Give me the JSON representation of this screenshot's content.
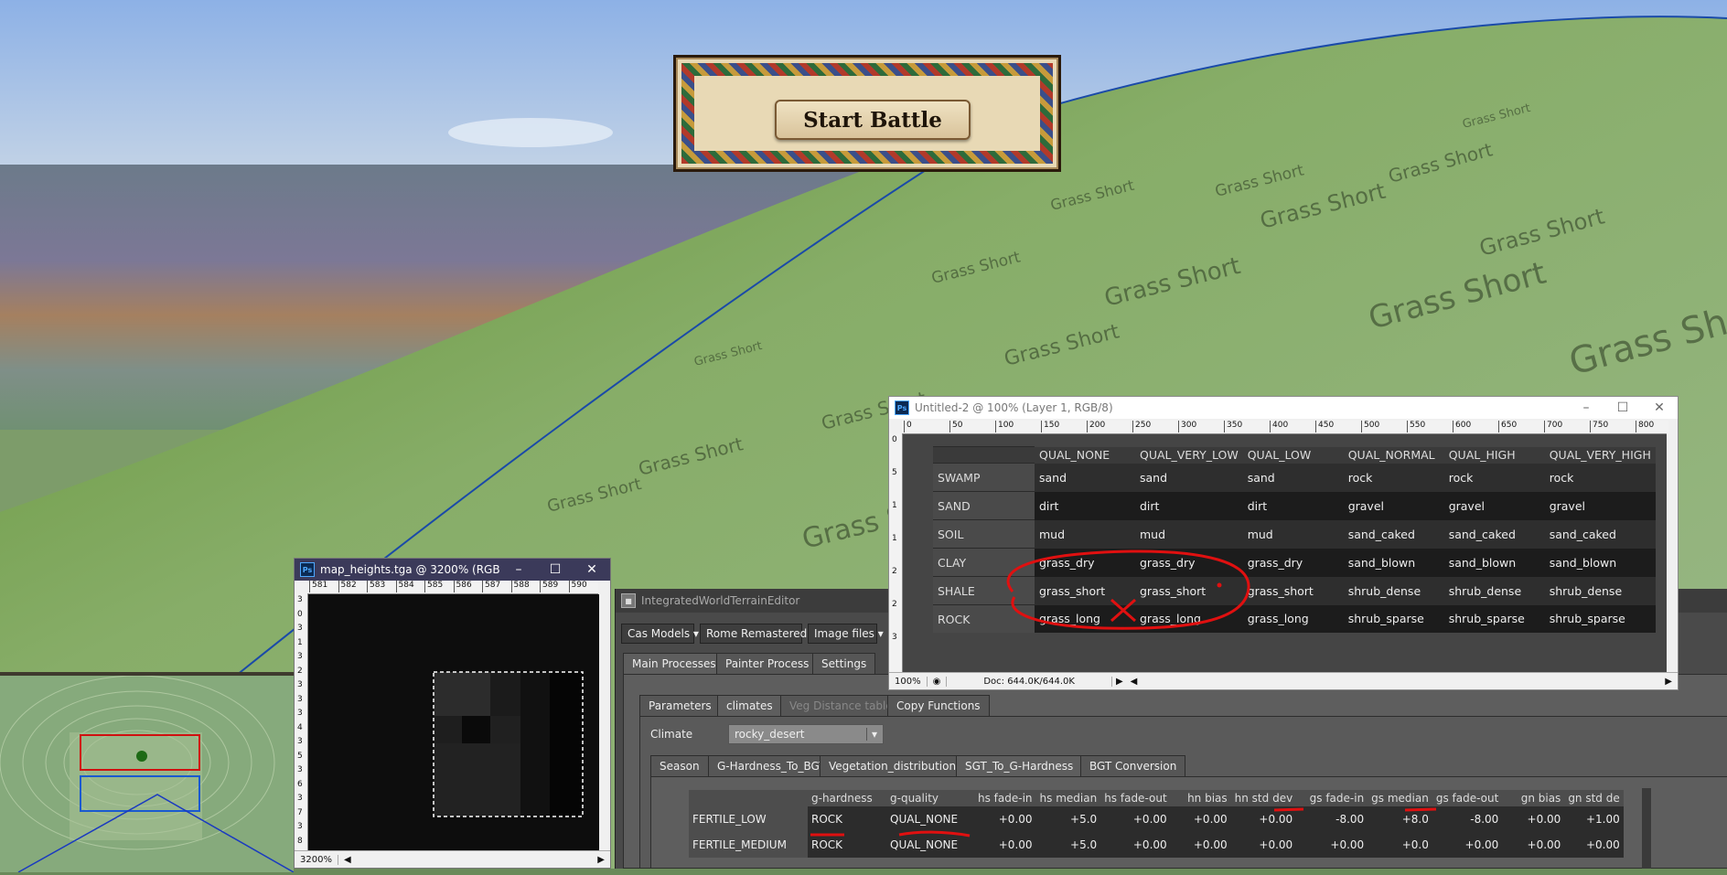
{
  "scene": {
    "terrain_label": "Grass Short"
  },
  "banner": {
    "label": "Start Battle"
  },
  "ps_window_1": {
    "title": "Untitled-2 @ 100% (Layer 1, RGB/8)",
    "ruler_ticks": [
      "0",
      "50",
      "100",
      "150",
      "200",
      "250",
      "300",
      "350",
      "400",
      "450",
      "500",
      "550",
      "600",
      "650",
      "700",
      "750",
      "800"
    ],
    "vruler_ticks": [
      "0",
      "5",
      "1",
      "1",
      "2",
      "2",
      "3"
    ],
    "zoom": "100%",
    "doc_info": "Doc: 644.0K/644.0K",
    "columns": [
      "QUAL_NONE",
      "QUAL_VERY_LOW",
      "QUAL_LOW",
      "QUAL_NORMAL",
      "QUAL_HIGH",
      "QUAL_VERY_HIGH"
    ],
    "rows": [
      {
        "name": "SWAMP",
        "cells": [
          "sand",
          "sand",
          "sand",
          "rock",
          "rock",
          "rock"
        ]
      },
      {
        "name": "SAND",
        "cells": [
          "dirt",
          "dirt",
          "dirt",
          "gravel",
          "gravel",
          "gravel"
        ]
      },
      {
        "name": "SOIL",
        "cells": [
          "mud",
          "mud",
          "mud",
          "sand_caked",
          "sand_caked",
          "sand_caked"
        ]
      },
      {
        "name": "CLAY",
        "cells": [
          "grass_dry",
          "grass_dry",
          "grass_dry",
          "sand_blown",
          "sand_blown",
          "sand_blown"
        ]
      },
      {
        "name": "SHALE",
        "cells": [
          "grass_short",
          "grass_short",
          "grass_short",
          "shrub_dense",
          "shrub_dense",
          "shrub_dense"
        ]
      },
      {
        "name": "ROCK",
        "cells": [
          "grass_long",
          "grass_long",
          "grass_long",
          "shrub_sparse",
          "shrub_sparse",
          "shrub_sparse"
        ]
      }
    ]
  },
  "ps_window_2": {
    "title": "map_heights.tga @ 3200% (RGB...",
    "ruler_ticks": [
      "581",
      "582",
      "583",
      "584",
      "585",
      "586",
      "587",
      "588",
      "589",
      "590"
    ],
    "vruler_ticks": [
      "3",
      "0",
      "3",
      "1",
      "3",
      "2",
      "3",
      "3",
      "3",
      "4",
      "3",
      "5",
      "3",
      "6",
      "3",
      "7",
      "3",
      "8"
    ],
    "zoom": "3200%"
  },
  "editor": {
    "title": "IntegratedWorldTerrainEditor",
    "dropdowns": [
      "Cas Models",
      "Rome Remastered",
      "Image files"
    ],
    "main_tabs": [
      "Main Processes",
      "Painter Process",
      "Settings"
    ],
    "sub_tabs": [
      "Parameters",
      "climates",
      "Veg Distance table",
      "Copy Functions"
    ],
    "climate_label": "Climate",
    "climate_value": "rocky_desert",
    "inner_tabs": [
      "Season",
      "G-Hardness_To_BGT",
      "Vegetation_distribution",
      "SGT_To_G-Hardness",
      "BGT Conversion"
    ],
    "hardness_columns": [
      "g-hardness",
      "g-quality",
      "hs fade-in",
      "hs median",
      "hs fade-out",
      "hn bias",
      "hn std dev",
      "gs fade-in",
      "gs median",
      "gs fade-out",
      "gn bias",
      "gn std de"
    ],
    "hardness_rows": [
      {
        "name": "FERTILE_LOW",
        "cells": [
          "ROCK",
          "QUAL_NONE",
          "+0.00",
          "+5.0",
          "+0.00",
          "+0.00",
          "+0.00",
          "-8.00",
          "+8.0",
          "-8.00",
          "+0.00",
          "+1.00"
        ]
      },
      {
        "name": "FERTILE_MEDIUM",
        "cells": [
          "ROCK",
          "QUAL_NONE",
          "+0.00",
          "+5.0",
          "+0.00",
          "+0.00",
          "+0.00",
          "+0.00",
          "+0.0",
          "+0.00",
          "+0.00",
          "+0.00"
        ]
      }
    ]
  },
  "colors": {
    "annotation_red": "#e01010",
    "terrain_green": "#7aa35a",
    "sky_blue": "#9ab8e0"
  }
}
